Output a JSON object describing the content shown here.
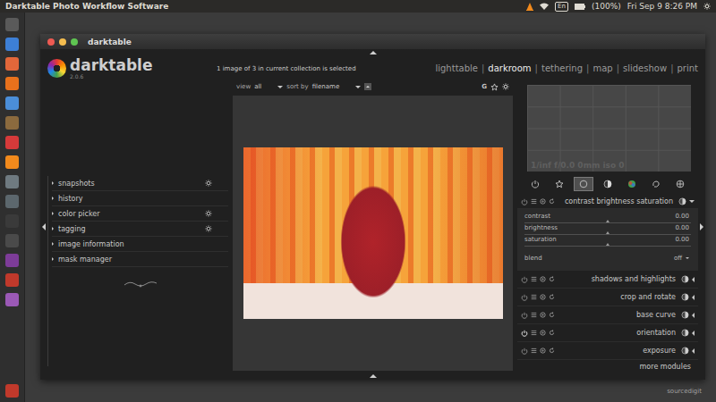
{
  "topbar": {
    "title": "Darktable Photo Workflow Software",
    "keyboard": "En",
    "battery": "(100%)",
    "clock": "Fri Sep 9 8:26 PM"
  },
  "dock": {
    "apps": [
      {
        "color": "#5a5a5a"
      },
      {
        "color": "#3d7fd6"
      },
      {
        "color": "#e2673a"
      },
      {
        "color": "#e8711c"
      },
      {
        "color": "#4b8ed8"
      },
      {
        "color": "#8b6a3e"
      },
      {
        "color": "#d63a3a"
      },
      {
        "color": "#f28a1c"
      },
      {
        "color": "#6f7a80"
      },
      {
        "color": "#5c676d"
      },
      {
        "color": "#3a3a3a"
      },
      {
        "color": "#4a4a4a"
      },
      {
        "color": "#7d3c98"
      },
      {
        "color": "#c0392b"
      },
      {
        "color": "#9b59b6"
      }
    ],
    "trash": {
      "color": "#c0392b"
    }
  },
  "window": {
    "title": "darktable"
  },
  "logo": {
    "name": "darktable",
    "version": "2.0.6"
  },
  "collection_status": "1 image of 3 in current collection is selected",
  "views": {
    "separator": "|",
    "items": [
      {
        "label": "lighttable",
        "selected": false
      },
      {
        "label": "darkroom",
        "selected": true
      },
      {
        "label": "tethering",
        "selected": false
      },
      {
        "label": "map",
        "selected": false
      },
      {
        "label": "slideshow",
        "selected": false
      },
      {
        "label": "print",
        "selected": false
      }
    ]
  },
  "left_panel": {
    "modules": [
      {
        "label": "snapshots",
        "has_presets": true
      },
      {
        "label": "history",
        "has_presets": false
      },
      {
        "label": "color picker",
        "has_presets": true
      },
      {
        "label": "tagging",
        "has_presets": true
      },
      {
        "label": "image information",
        "has_presets": false
      },
      {
        "label": "mask manager",
        "has_presets": false
      }
    ]
  },
  "center_toolbar": {
    "view_label": "view",
    "view_value": "all",
    "sort_label": "sort by",
    "sort_value": "filename",
    "grouping": "G"
  },
  "histogram": {
    "exif": "1/inf f/0.0 0mm iso 0"
  },
  "module_groups": [
    {
      "kind": "power",
      "selected": false
    },
    {
      "kind": "star",
      "selected": false
    },
    {
      "kind": "circle",
      "selected": true
    },
    {
      "kind": "tone",
      "selected": false
    },
    {
      "kind": "color",
      "selected": false
    },
    {
      "kind": "correct",
      "selected": false
    },
    {
      "kind": "effect",
      "selected": false
    }
  ],
  "right_modules": [
    {
      "name": "contrast brightness saturation",
      "expanded": true,
      "enabled": false,
      "sliders": [
        {
          "label": "contrast",
          "value": "0.00",
          "level": 0.5
        },
        {
          "label": "brightness",
          "value": "0.00",
          "level": 0.5
        },
        {
          "label": "saturation",
          "value": "0.00",
          "level": 0.5
        }
      ],
      "blend": {
        "label": "blend",
        "value": "off"
      }
    },
    {
      "name": "shadows and highlights",
      "expanded": false,
      "enabled": false
    },
    {
      "name": "crop and rotate",
      "expanded": false,
      "enabled": false
    },
    {
      "name": "base curve",
      "expanded": false,
      "enabled": false
    },
    {
      "name": "orientation",
      "expanded": false,
      "enabled": true
    },
    {
      "name": "exposure",
      "expanded": false,
      "enabled": false
    }
  ],
  "more_modules": "more modules",
  "watermark": "sourcedigit"
}
